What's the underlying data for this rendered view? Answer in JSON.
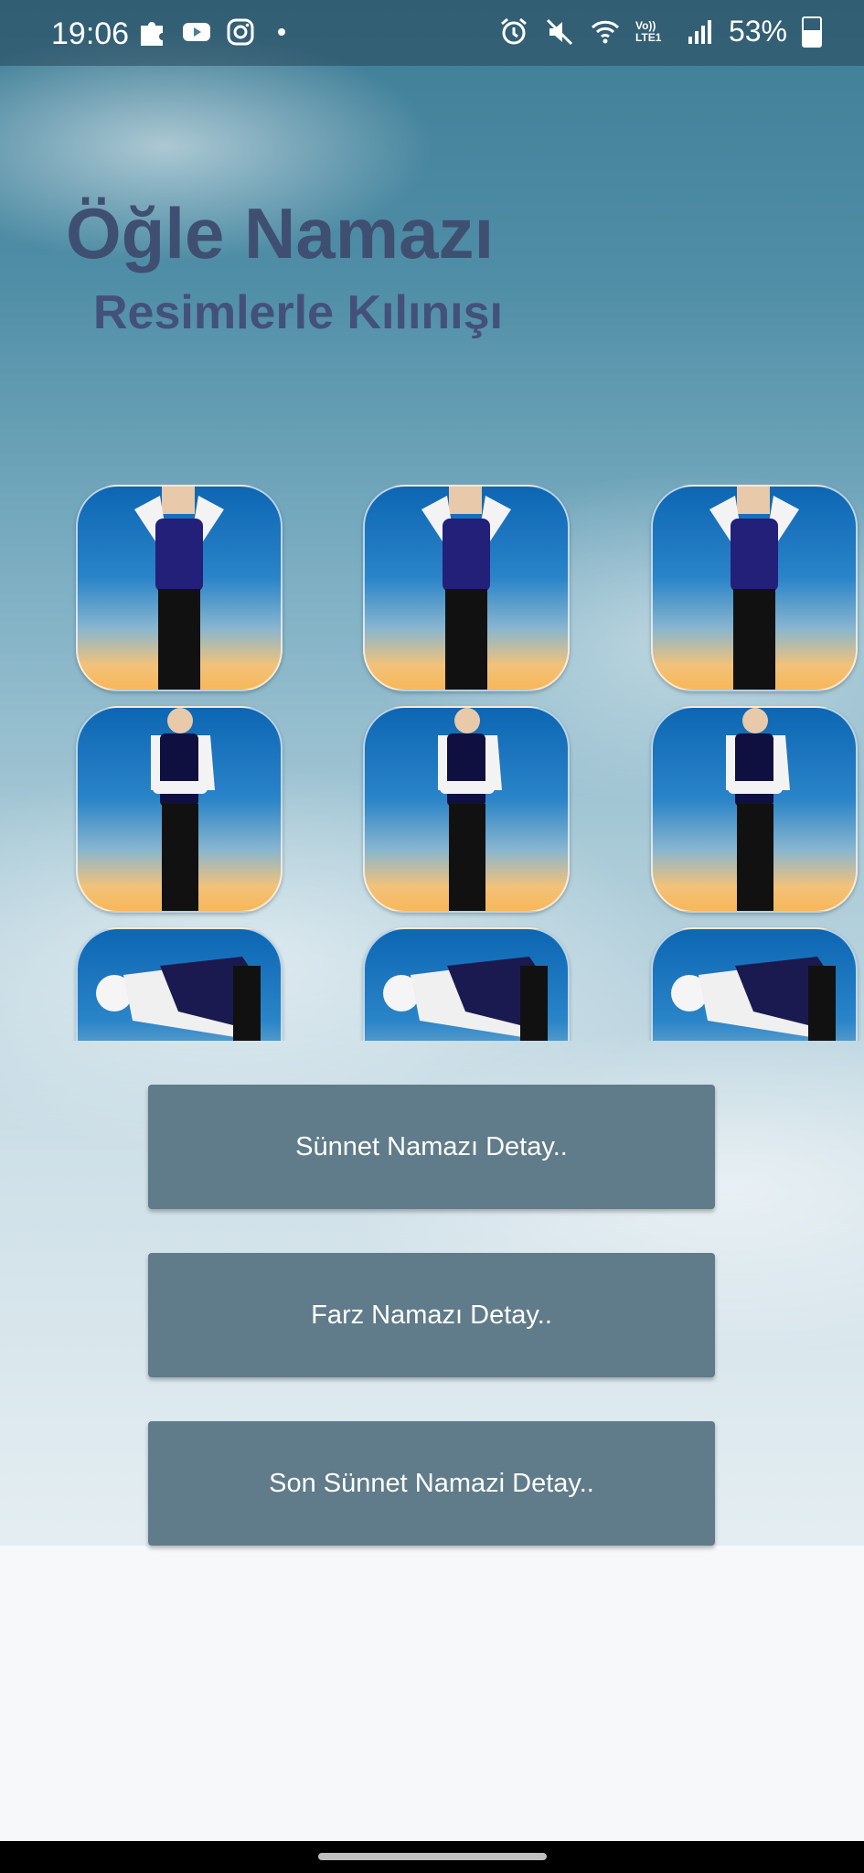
{
  "status_bar": {
    "time": "19:06",
    "battery": "53%",
    "left_icons": [
      "puzzle-icon",
      "youtube-icon",
      "instagram-icon",
      "dot-icon"
    ],
    "right_icons": [
      "alarm-icon",
      "mute-icon",
      "wifi-icon",
      "volte-icon",
      "signal-icon",
      "battery-icon"
    ],
    "volte_label": "Vo)) LTE1"
  },
  "header": {
    "title": "Öğle Namazı",
    "subtitle": "Resimlerle Kılınışı"
  },
  "poses": [
    {
      "row": 1,
      "pose": "takbir-standing"
    },
    {
      "row": 2,
      "pose": "kiyam-standing"
    },
    {
      "row": 3,
      "pose": "ruku-bowing"
    }
  ],
  "buttons": {
    "sunnet": "Sünnet Namazı Detay..",
    "farz": "Farz Namazı Detay..",
    "son_sunnet": "Son Sünnet Namazi Detay.."
  },
  "colors": {
    "title": "#3f4f72",
    "button_bg": "#607b89",
    "button_text": "#ffffff"
  }
}
